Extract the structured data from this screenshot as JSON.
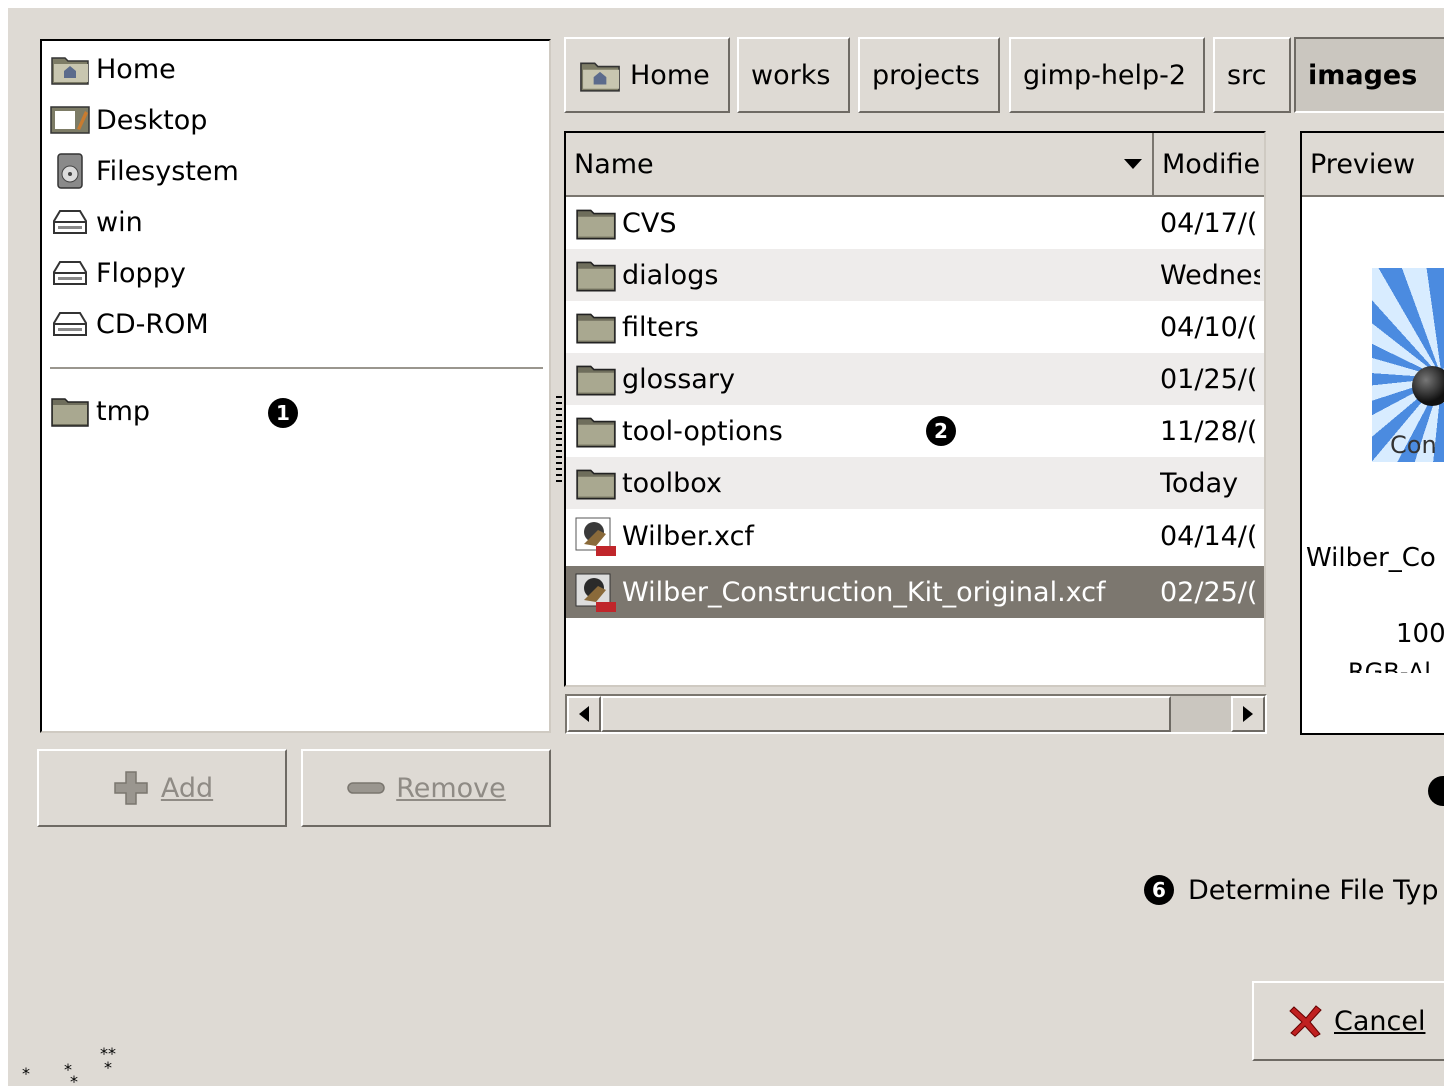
{
  "places": {
    "items": [
      {
        "label": "Home",
        "icon": "home-folder-icon"
      },
      {
        "label": "Desktop",
        "icon": "desktop-icon"
      },
      {
        "label": "Filesystem",
        "icon": "filesystem-icon"
      },
      {
        "label": "win",
        "icon": "drive-icon"
      },
      {
        "label": "Floppy",
        "icon": "drive-icon"
      },
      {
        "label": "CD-ROM",
        "icon": "drive-icon"
      }
    ],
    "bookmarks": [
      {
        "label": "tmp",
        "icon": "folder-icon"
      }
    ],
    "marker": "1"
  },
  "buttons": {
    "add_label": "Add",
    "remove_label": "Remove",
    "cancel_label": "Cancel"
  },
  "path_bar": [
    "Home",
    "works",
    "projects",
    "gimp-help-2",
    "src",
    "images"
  ],
  "file_list": {
    "columns": [
      "Name",
      "Modifie"
    ],
    "rows": [
      {
        "name": "CVS",
        "modified": "04/17/(",
        "type": "folder"
      },
      {
        "name": "dialogs",
        "modified": "Wednes",
        "type": "folder"
      },
      {
        "name": "filters",
        "modified": "04/10/(",
        "type": "folder"
      },
      {
        "name": "glossary",
        "modified": "01/25/(",
        "type": "folder"
      },
      {
        "name": "tool-options",
        "modified": "11/28/(",
        "type": "folder"
      },
      {
        "name": "toolbox",
        "modified": "Today",
        "type": "folder"
      },
      {
        "name": "Wilber.xcf",
        "modified": "04/14/(",
        "type": "xcf"
      },
      {
        "name": "Wilber_Construction_Kit_original.xcf",
        "modified": "02/25/(",
        "type": "xcf",
        "selected": true
      }
    ],
    "marker": "2"
  },
  "preview": {
    "header": "Preview",
    "thumb_text": "Con",
    "filename": "Wilber_Co",
    "size": "100",
    "mode": "RGB-Al"
  },
  "file_type": {
    "marker": "6",
    "label": "Determine File Typ"
  },
  "stars": [
    "*",
    "*",
    "*",
    "**",
    "*"
  ],
  "colors": {
    "background": "#dedad4",
    "selection": "#7c776f",
    "alt_row": "#eeeceb"
  }
}
